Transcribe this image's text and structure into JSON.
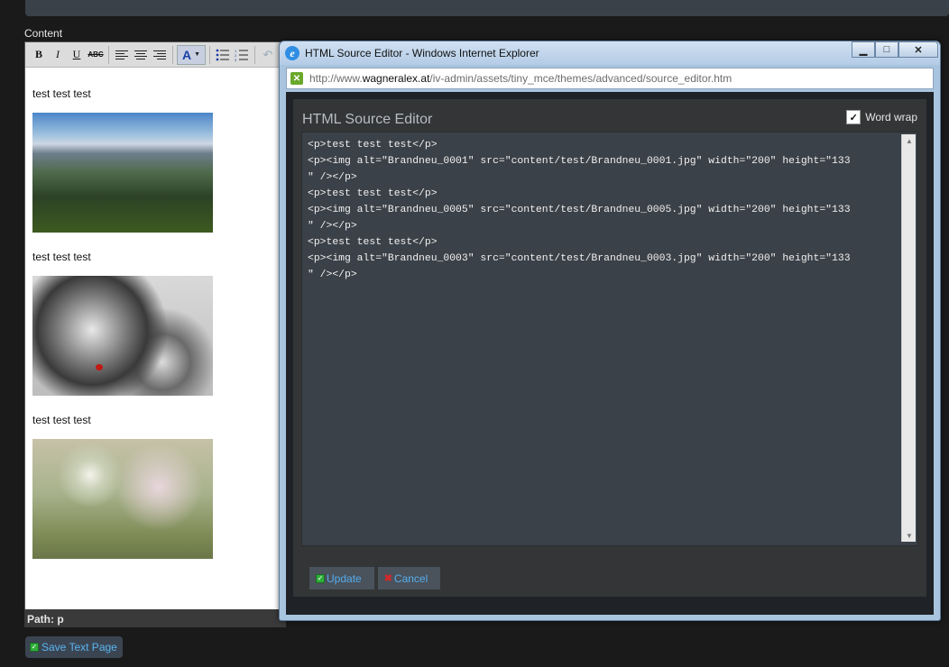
{
  "content_label": "Content",
  "toolbar": {
    "bold": "B",
    "italic": "I",
    "underline": "U",
    "strikethrough": "ABC",
    "font_color": "A"
  },
  "document": {
    "paragraph_1": "test test test",
    "paragraph_2": "test test test",
    "paragraph_3": "test test test"
  },
  "path_bar": "Path: p",
  "save_button": "Save Text Page",
  "ie_window": {
    "title": "HTML Source Editor - Windows Internet Explorer",
    "address_prefix": "http://www.",
    "address_domain": "wagneralex.at",
    "address_path": "/iv-admin/assets/tiny_mce/themes/advanced/source_editor.htm"
  },
  "source_editor": {
    "title": "HTML Source Editor",
    "word_wrap_label": "Word wrap",
    "word_wrap_checked": true,
    "source_lines": [
      "<p>test test test</p>",
      "<p><img alt=\"Brandneu_0001\" src=\"content/test/Brandneu_0001.jpg\" width=\"200\" height=\"133",
      "\" /></p>",
      "<p>test test test</p>",
      "<p><img alt=\"Brandneu_0005\" src=\"content/test/Brandneu_0005.jpg\" width=\"200\" height=\"133",
      "\" /></p>",
      "<p>test test test</p>",
      "<p><img alt=\"Brandneu_0003\" src=\"content/test/Brandneu_0003.jpg\" width=\"200\" height=\"133",
      "\" /></p>"
    ],
    "update_label": "Update",
    "cancel_label": "Cancel"
  },
  "colors": {
    "link_blue": "#56aef0",
    "panel_dark": "#333537",
    "source_bg": "#3b4148"
  }
}
